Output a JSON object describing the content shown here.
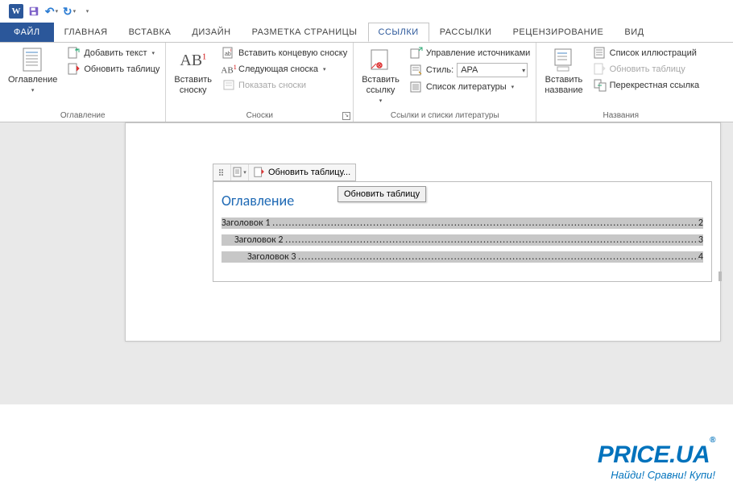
{
  "qat": {
    "save": "Сохранить",
    "undo": "Отменить",
    "redo": "Повторить"
  },
  "tabs": {
    "file": "ФАЙЛ",
    "home": "ГЛАВНАЯ",
    "insert": "ВСТАВКА",
    "design": "ДИЗАЙН",
    "layout": "РАЗМЕТКА СТРАНИЦЫ",
    "references": "ССЫЛКИ",
    "mailings": "РАССЫЛКИ",
    "review": "РЕЦЕНЗИРОВАНИЕ",
    "view": "ВИД"
  },
  "ribbon": {
    "toc": {
      "big": "Оглавление",
      "add_text": "Добавить текст",
      "update": "Обновить таблицу",
      "group": "Оглавление"
    },
    "footnotes": {
      "big": "Вставить\nсноску",
      "insert_end": "Вставить концевую сноску",
      "next": "Следующая сноска",
      "show": "Показать сноски",
      "group": "Сноски"
    },
    "citations": {
      "big": "Вставить\nссылку",
      "manage": "Управление источниками",
      "style_label": "Стиль:",
      "style_value": "APA",
      "biblio": "Список литературы",
      "group": "Ссылки и списки литературы"
    },
    "captions": {
      "big": "Вставить\nназвание",
      "figures": "Список иллюстраций",
      "update": "Обновить таблицу",
      "crossref": "Перекрестная ссылка",
      "group": "Названия"
    }
  },
  "doc": {
    "toolbar_update": "Обновить таблицу...",
    "tooltip": "Обновить таблицу",
    "toc_title": "Оглавление",
    "entries": [
      {
        "text": "Заголовок 1",
        "page": "2",
        "level": 1
      },
      {
        "text": "Заголовок 2",
        "page": "3",
        "level": 2
      },
      {
        "text": "Заголовок 3",
        "page": "4",
        "level": 3
      }
    ]
  },
  "brand": {
    "main": "PRICE.UA",
    "reg": "®",
    "sub": "Найди! Сравни! Купи!"
  }
}
